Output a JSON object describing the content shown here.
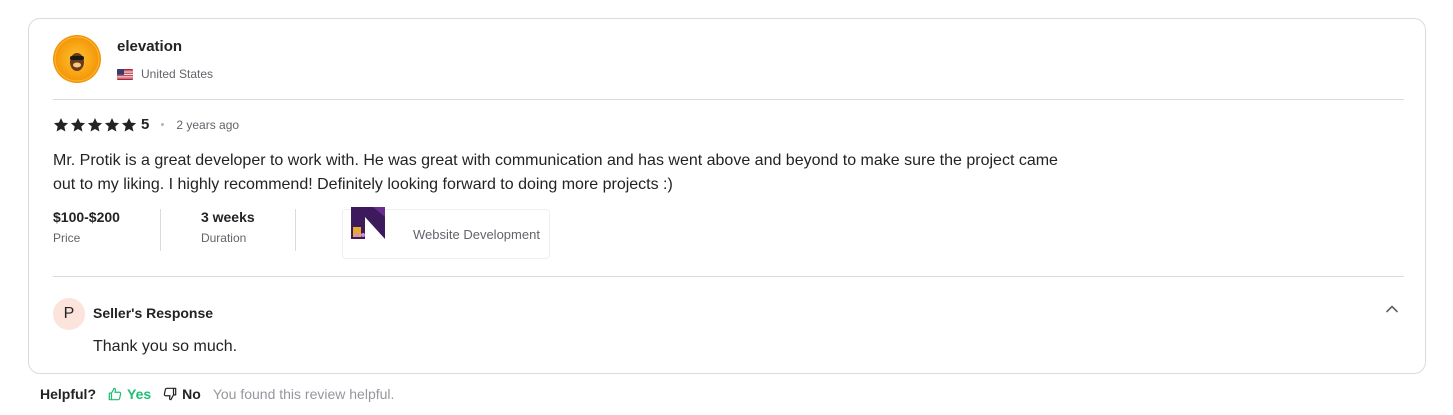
{
  "review": {
    "username": "elevation",
    "country": "United States",
    "rating": "5",
    "time_ago": "2 years ago",
    "text_line1": "Mr. Protik is a great developer to work with. He was great with communication and has went above and beyond to make sure the project came",
    "text_line2": "out to my liking. I highly recommend! Definitely looking forward to doing more projects :)",
    "price_value": "$100-$200",
    "price_label": "Price",
    "duration_value": "3 weeks",
    "duration_label": "Duration",
    "gig_label": "Website Development"
  },
  "seller_response": {
    "avatar_letter": "P",
    "title": "Seller's Response",
    "text": "Thank you so much."
  },
  "helpful": {
    "question": "Helpful?",
    "yes_label": "Yes",
    "no_label": "No",
    "status_text": "You found this review helpful."
  },
  "colors": {
    "accent_green": "#1dbf73",
    "text_dark": "#222325",
    "text_muted": "#62646a",
    "border": "#dadbdd"
  },
  "icons": [
    "user-avatar",
    "us-flag-icon",
    "star-icon",
    "chevron-up-icon",
    "thumbs-up-icon",
    "thumbs-down-icon",
    "gig-thumbnail"
  ]
}
